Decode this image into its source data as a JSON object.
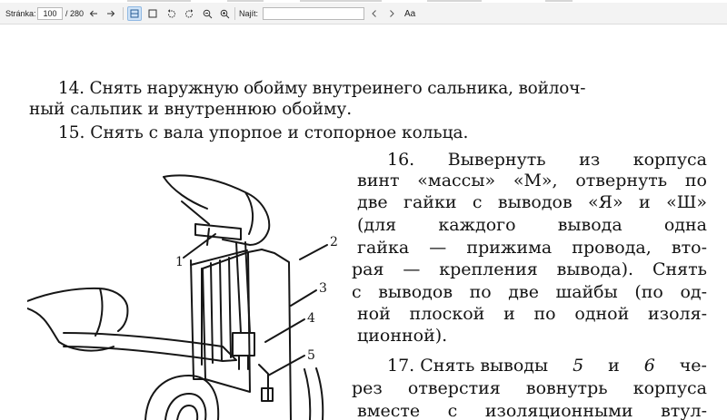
{
  "toolbar": {
    "page_label": "Stránka:",
    "page_current": "100",
    "page_total": "/ 280",
    "find_label": "Najít:",
    "find_placeholder": "",
    "icons": [
      "arrow-left-icon",
      "arrow-right-icon",
      "single-page-view-icon",
      "page-fit-icon",
      "rotate-left-icon",
      "rotate-right-icon",
      "zoom-out-icon",
      "zoom-in-icon",
      "chevron-left-icon",
      "chevron-right-icon",
      "text-options-icon"
    ],
    "font_toggle_label": "Aa",
    "accent_color": "#cfe3f7"
  },
  "document": {
    "line_14a": "14. Снять наружную обойму внутреинего сальника, войлоч-",
    "line_14b": "ный сальпик и внутреннюю обойму.",
    "line_15": "15. Снять с вала упорпое и стопорное кольца.",
    "line_16a": "16. Вывернуть   из   корпуса",
    "line_16b": "винт «массы» «М», отвернуть по",
    "line_16c": "две гайки с выводов «Я» и «Ш»",
    "line_16d": "(для   каждого   вывода   одна",
    "line_16e": "гайка — прижима провода, вто-",
    "line_16f": "рая — крепления вывода). Снять",
    "line_16g": "с выводов по две шайбы (по од-",
    "line_16h": "ной плоской и по одной изоля-",
    "line_16i": "ционной).",
    "line_17a_pre": "17. Снять выводы ",
    "line_17a_n1": "5",
    "line_17a_mid": " и ",
    "line_17a_n2": "6",
    "line_17a_post": " че-",
    "line_17b": "рез отверстия вовнутрь корпуса",
    "line_17c": "вместе с изоляционными втул-",
    "figure_labels": [
      "1",
      "2",
      "3",
      "4",
      "5"
    ]
  }
}
